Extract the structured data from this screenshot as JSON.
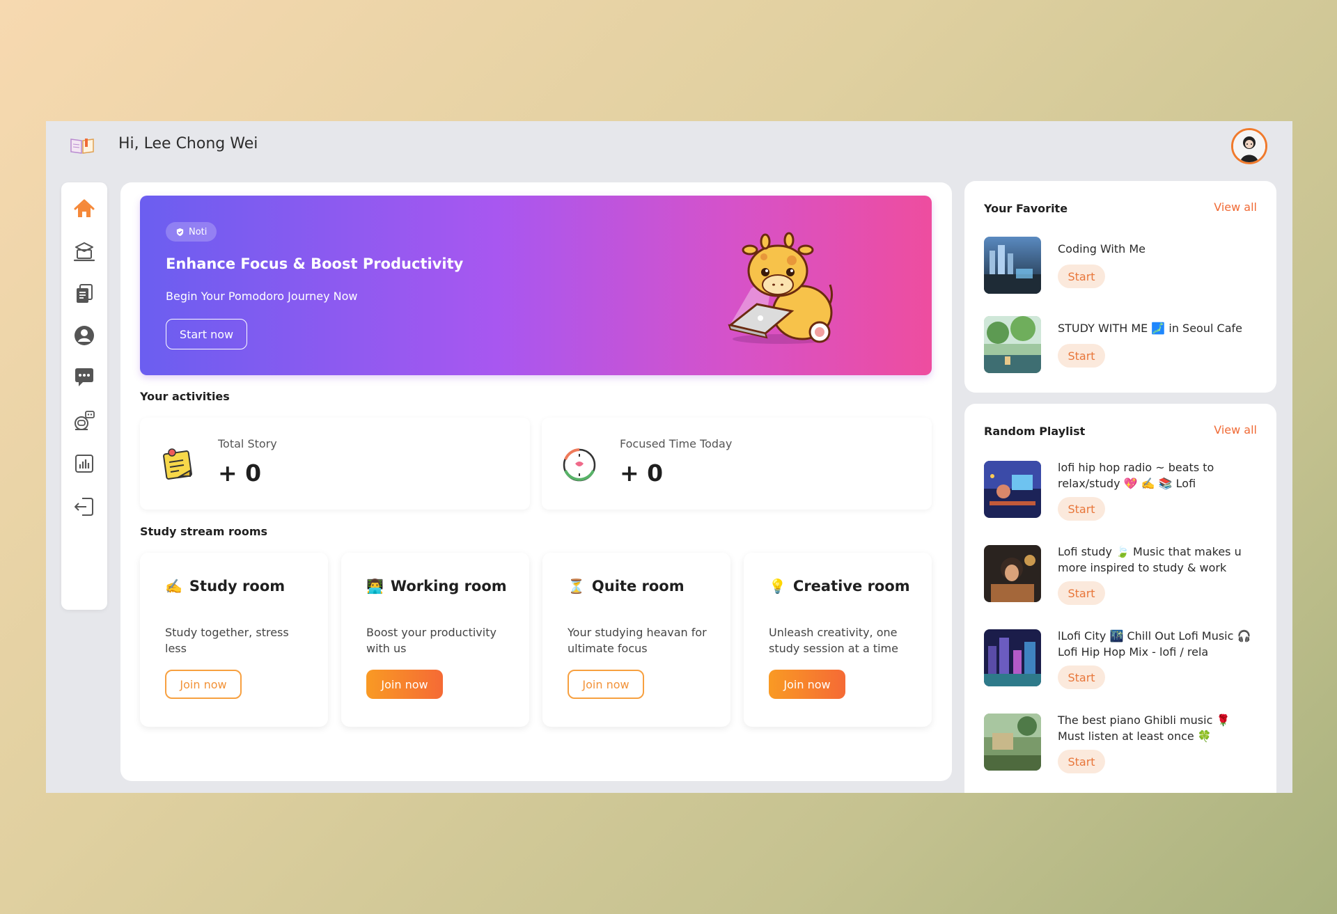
{
  "header": {
    "greeting": "Hi, Lee Chong Wei"
  },
  "sidebar": {
    "items": [
      {
        "icon": "home-icon",
        "active": true
      },
      {
        "icon": "laptop-study-icon",
        "active": false
      },
      {
        "icon": "documents-icon",
        "active": false
      },
      {
        "icon": "user-icon",
        "active": false
      },
      {
        "icon": "chat-icon",
        "active": false
      },
      {
        "icon": "robot-icon",
        "active": false
      },
      {
        "icon": "chart-icon",
        "active": false
      },
      {
        "icon": "logout-icon",
        "active": false
      }
    ]
  },
  "banner": {
    "badge": "Noti",
    "title": "Enhance Focus & Boost Productivity",
    "subtitle": "Begin Your Pomodoro Journey Now",
    "button": "Start now"
  },
  "activities": {
    "title": "Your activities",
    "stats": [
      {
        "label": "Total Story",
        "value": "+ 0"
      },
      {
        "label": "Focused Time Today",
        "value": "+ 0"
      }
    ]
  },
  "rooms": {
    "title": "Study stream rooms",
    "items": [
      {
        "emoji": "✍️",
        "title": "Study room",
        "desc": "Study together, stress less",
        "button": "Join now",
        "style": "outline"
      },
      {
        "emoji": "👨‍💻",
        "title": "Working room",
        "desc": "Boost your productivity with us",
        "button": "Join now",
        "style": "filled"
      },
      {
        "emoji": "⏳",
        "title": "Quite room",
        "desc": "Your studying heavan for ultimate focus",
        "button": "Join now",
        "style": "outline"
      },
      {
        "emoji": "💡",
        "title": "Creative room",
        "desc": "Unleash creativity, one study session at a time",
        "button": "Join now",
        "style": "filled"
      }
    ]
  },
  "favorite": {
    "title": "Your Favorite",
    "view_all": "View all",
    "tracks": [
      {
        "title": "Coding With Me",
        "button": "Start"
      },
      {
        "title": "STUDY WITH ME 🗾 in Seoul Cafe",
        "button": "Start"
      }
    ]
  },
  "playlist": {
    "title": "Random Playlist",
    "view_all": "View all",
    "tracks": [
      {
        "title": "lofi hip hop radio ~ beats to relax/study 💖 ✍️ 📚 Lofi",
        "button": "Start"
      },
      {
        "title": "Lofi study 🍃 Music that makes u more inspired to study & work",
        "button": "Start"
      },
      {
        "title": "lLofi City 🌃 Chill Out Lofi Music 🎧 Lofi Hip Hop Mix - lofi / rela",
        "button": "Start"
      },
      {
        "title": "The best piano Ghibli music 🌹 Must listen at least once 🍀",
        "button": "Start"
      }
    ]
  },
  "colors": {
    "accent": "#f06a35",
    "banner_start": "#6b5ef0",
    "banner_end": "#ee4d9f"
  }
}
